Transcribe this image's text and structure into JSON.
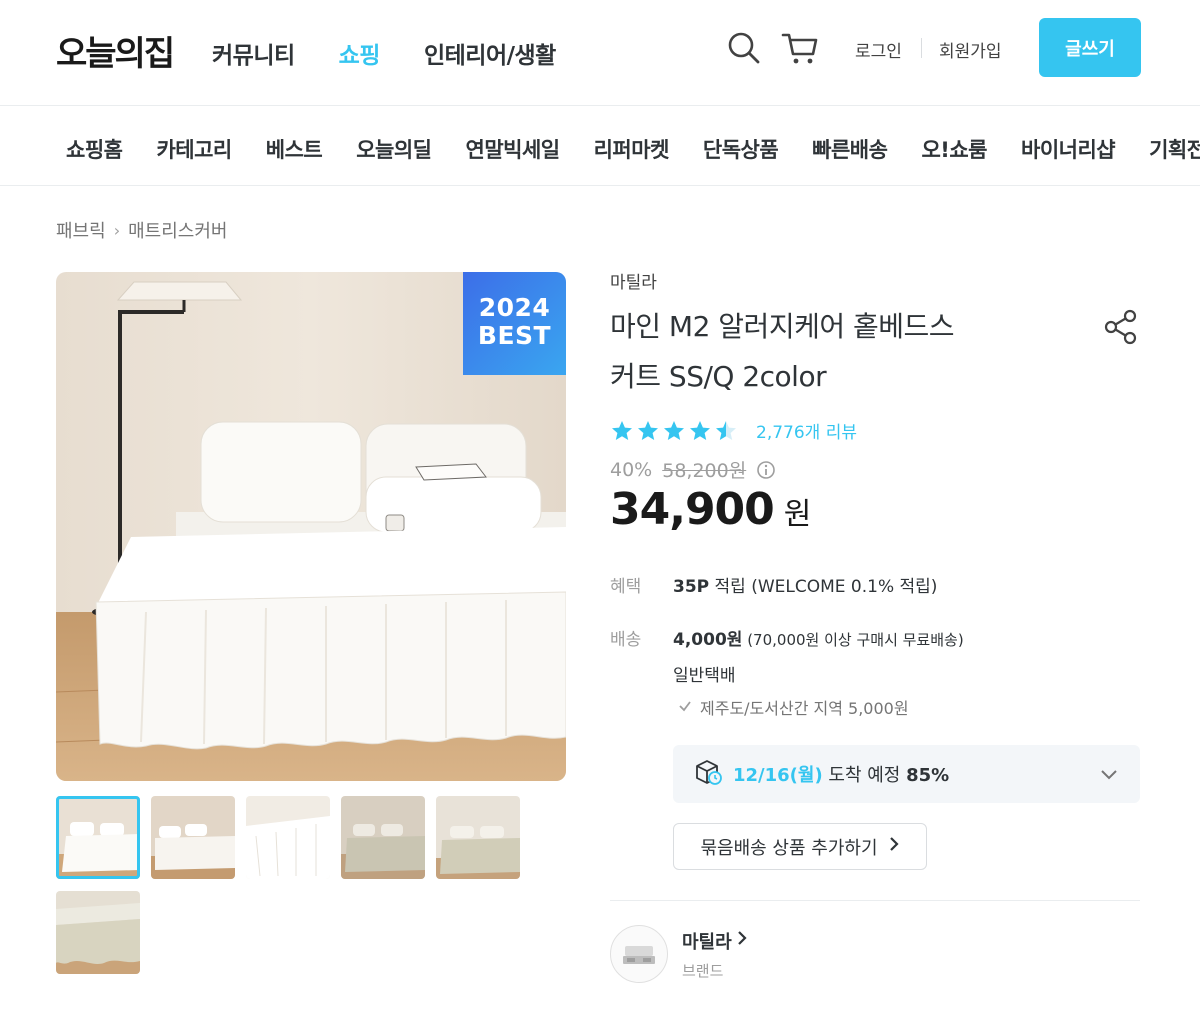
{
  "header": {
    "logo": "오늘의집",
    "nav": [
      {
        "label": "커뮤니티",
        "active": false
      },
      {
        "label": "쇼핑",
        "active": true
      },
      {
        "label": "인테리어/생활",
        "active": false
      }
    ],
    "login": "로그인",
    "signup": "회원가입",
    "write": "글쓰기"
  },
  "subnav": [
    "쇼핑홈",
    "카테고리",
    "베스트",
    "오늘의딜",
    "연말빅세일",
    "리퍼마켓",
    "단독상품",
    "빠른배송",
    "오!쇼룸",
    "바이너리샵",
    "기획전"
  ],
  "breadcrumb": [
    "패브릭",
    "매트리스커버"
  ],
  "badge": {
    "year": "2024",
    "label": "BEST"
  },
  "product": {
    "brand": "마틸라",
    "title_line1": "마인 M2 알러지케어 홑베드스",
    "title_line2": "커트 SS/Q 2color",
    "rating": 4.5,
    "reviews": "2,776개 리뷰",
    "discount": "40%",
    "original_price": "58,200원",
    "price": "34,900",
    "price_unit": "원"
  },
  "benefit": {
    "label": "혜택",
    "points": "35P",
    "text": " 적립 (WELCOME 0.1% 적립)"
  },
  "shipping": {
    "label": "배송",
    "fee": "4,000원",
    "note": " (70,000원 이상 구매시 무료배송)",
    "type": "일반택배",
    "extra": "제주도/도서산간 지역 5,000원"
  },
  "arrival": {
    "date": "12/16(월)",
    "text": " 도착 예정 ",
    "pct": "85%"
  },
  "bundle": "묶음배송 상품 추가하기",
  "brand_card": {
    "name": "마틸라",
    "sub": "브랜드"
  },
  "colors": {
    "accent": "#35c5f0",
    "badge_from": "#3c6ee8",
    "badge_to": "#3aa6f0"
  }
}
